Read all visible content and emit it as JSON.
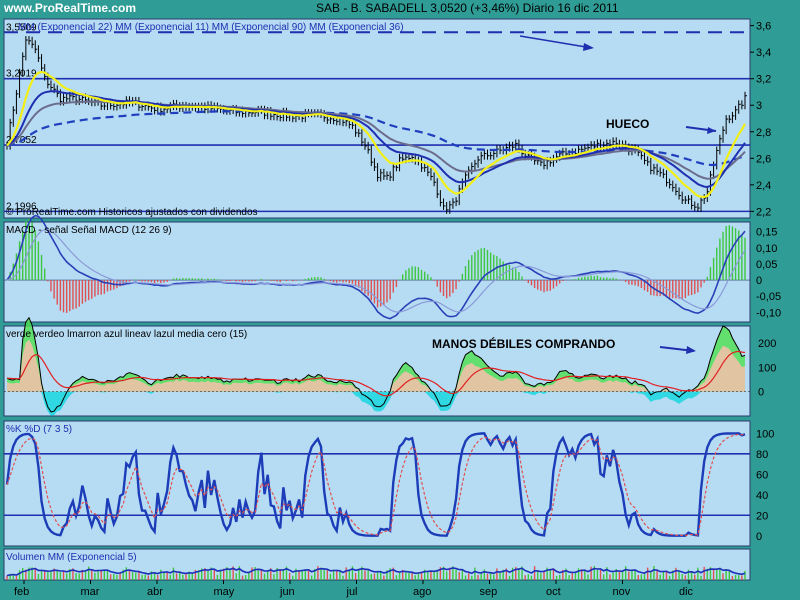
{
  "header": {
    "site": "www.ProRealTime.com",
    "title": "SAB - B. SABADELL    3,0520 (+3,46%)    Diario  16 dic 2011"
  },
  "colors": {
    "background": "#2f9c96",
    "panel": "#b6dcf4",
    "price_bars": "#000000",
    "ema22": "#1f2fb0",
    "ema11": "#f2ef14",
    "ema90": "#1f3fbf",
    "ema36": "#6c6c8c",
    "macd": "#2a3fb8",
    "signal": "#e03636",
    "hist_pos": "#3ec73e",
    "hist_neg": "#e05050",
    "verde": "#4ee04e",
    "marron": "#f0c2a8",
    "azul": "#20d7e0",
    "media": "#e02020",
    "k": "#1c3cb8",
    "d": "#e05050",
    "volume_line": "#1c2fb8"
  },
  "xaxis": [
    "feb",
    "mar",
    "abr",
    "may",
    "jun",
    "jul",
    "ago",
    "sep",
    "oct",
    "nov",
    "dic"
  ],
  "annotations": {
    "hueco": "HUECO",
    "manos": "MANOS DÉBILES COMPRANDO"
  },
  "chart_data": [
    {
      "type": "line",
      "panel": "price",
      "title": "MM (Exponencial 22) MM (Exponencial 11) MM (Exponencial 90) MM (Exponencial 36)",
      "source_note": "© ProRealTime.com  Historicos ajustados con dividendos",
      "yticks": [
        2.2,
        2.4,
        2.6,
        2.8,
        3,
        3.2,
        3.4,
        3.6
      ],
      "ylim": [
        2.15,
        3.65
      ],
      "levels": [
        {
          "label": "3,5509",
          "value": 3.55
        },
        {
          "label": "3,2019",
          "value": 3.2
        },
        {
          "label": "2,7052",
          "value": 2.7
        },
        {
          "label": "2,1996",
          "value": 2.2
        }
      ],
      "close_anchors": [
        [
          0,
          2.72
        ],
        [
          3,
          3.1
        ],
        [
          6,
          3.5
        ],
        [
          9,
          3.42
        ],
        [
          12,
          3.2
        ],
        [
          17,
          3.05
        ],
        [
          22,
          3.05
        ],
        [
          30,
          3.0
        ],
        [
          40,
          3.02
        ],
        [
          48,
          2.97
        ],
        [
          56,
          3.0
        ],
        [
          64,
          2.98
        ],
        [
          72,
          2.95
        ],
        [
          80,
          2.95
        ],
        [
          90,
          2.92
        ],
        [
          100,
          2.92
        ],
        [
          106,
          2.9
        ],
        [
          110,
          2.84
        ],
        [
          114,
          2.7
        ],
        [
          118,
          2.48
        ],
        [
          121,
          2.45
        ],
        [
          125,
          2.58
        ],
        [
          129,
          2.62
        ],
        [
          132,
          2.55
        ],
        [
          136,
          2.42
        ],
        [
          139,
          2.22
        ],
        [
          142,
          2.25
        ],
        [
          146,
          2.45
        ],
        [
          150,
          2.6
        ],
        [
          156,
          2.65
        ],
        [
          162,
          2.7
        ],
        [
          166,
          2.6
        ],
        [
          170,
          2.55
        ],
        [
          176,
          2.62
        ],
        [
          182,
          2.66
        ],
        [
          188,
          2.7
        ],
        [
          194,
          2.72
        ],
        [
          200,
          2.65
        ],
        [
          204,
          2.55
        ],
        [
          208,
          2.48
        ],
        [
          212,
          2.4
        ],
        [
          216,
          2.28
        ],
        [
          220,
          2.24
        ],
        [
          223,
          2.35
        ],
        [
          226,
          2.65
        ],
        [
          229,
          2.9
        ],
        [
          232,
          2.95
        ],
        [
          235,
          3.05
        ]
      ],
      "series": [
        {
          "name": "Exponencial 22",
          "key": "ema22"
        },
        {
          "name": "Exponencial 11",
          "key": "ema11"
        },
        {
          "name": "Exponencial 90",
          "key": "ema90"
        },
        {
          "name": "Exponencial 36",
          "key": "ema36"
        }
      ]
    },
    {
      "type": "line",
      "panel": "macd",
      "title": "MACD - señal Señal MACD (12 26 9)",
      "yticks": [
        0.15,
        0.1,
        0.05,
        0,
        -0.05,
        -0.1
      ],
      "ylim": [
        -0.13,
        0.18
      ],
      "series": [
        {
          "name": "MACD"
        },
        {
          "name": "Señal"
        }
      ]
    },
    {
      "type": "area",
      "panel": "flow",
      "title": "verde verdeo lmarron azul lineav lazul media cero (15)",
      "yticks": [
        200,
        100,
        0
      ],
      "ylim": [
        -100,
        270
      ],
      "series": [
        {
          "name": "verde"
        },
        {
          "name": "lmarron"
        },
        {
          "name": "azul"
        },
        {
          "name": "media"
        }
      ]
    },
    {
      "type": "line",
      "panel": "stoch",
      "title": "%K %D (7 3 5)",
      "yticks": [
        100,
        80,
        60,
        40,
        20,
        0
      ],
      "ylim": [
        -10,
        112
      ],
      "levels": [
        80,
        20
      ],
      "series": [
        {
          "name": "%K"
        },
        {
          "name": "%D"
        }
      ]
    },
    {
      "type": "bar",
      "panel": "volume",
      "title": "Volumen MM (Exponencial 5)",
      "series": [
        {
          "name": "Volumen"
        },
        {
          "name": "MM Exponencial 5"
        }
      ]
    }
  ]
}
